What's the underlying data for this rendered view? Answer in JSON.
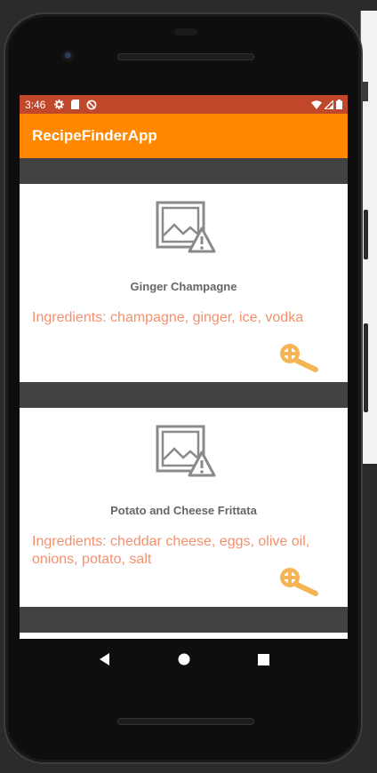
{
  "status_bar": {
    "time": "3:46",
    "left_icons": [
      "gear-icon",
      "sd-card-icon",
      "data-saver-icon"
    ],
    "right_icons": [
      "wifi-icon",
      "signal-icon",
      "battery-icon"
    ]
  },
  "app_bar": {
    "title": "RecipeFinderApp"
  },
  "recipes": [
    {
      "title": "Ginger Champagne",
      "ingredients": "Ingredients: champagne, ginger, ice, vodka",
      "image": "broken-image-icon",
      "action_icon": "search-icon"
    },
    {
      "title": "Potato and Cheese Frittata",
      "ingredients": "Ingredients: cheddar cheese, eggs, olive oil, onions, potato, salt",
      "image": "broken-image-icon",
      "action_icon": "search-icon"
    }
  ],
  "nav_bar": {
    "buttons": [
      "back-icon",
      "home-icon",
      "recents-icon"
    ]
  },
  "colors": {
    "status_bar": "#c0472a",
    "app_bar": "#ff8800",
    "ingredients_text": "#f4906e",
    "search_icon": "#f5b455",
    "list_background": "#424242"
  }
}
